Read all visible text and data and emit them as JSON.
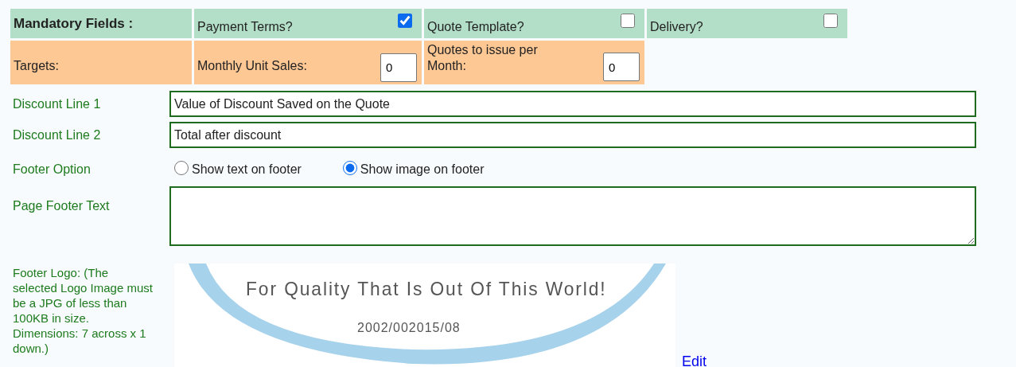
{
  "mandatory": {
    "label": "Mandatory Fields :",
    "items": [
      {
        "label": "Payment Terms?",
        "checked": true
      },
      {
        "label": "Quote Template?",
        "checked": false
      },
      {
        "label": "Delivery?",
        "checked": false
      }
    ]
  },
  "targets": {
    "label": "Targets:",
    "items": [
      {
        "label": "Monthly Unit Sales:",
        "value": "0"
      },
      {
        "label": "Quotes to issue per Month:",
        "value": "0"
      }
    ]
  },
  "discount_lines": [
    {
      "label": "Discount Line 1",
      "value": "Value of Discount Saved on the Quote"
    },
    {
      "label": "Discount Line 2",
      "value": "Total after discount"
    }
  ],
  "footer_option": {
    "label": "Footer Option",
    "options": [
      {
        "label": "Show text on footer",
        "selected": false
      },
      {
        "label": "Show image on footer",
        "selected": true
      }
    ]
  },
  "page_footer_text": {
    "label": "Page Footer Text"
  },
  "footer_logo": {
    "label": "Footer Logo: (The selected Logo Image must be a JPG of less than 100KB in size. Dimensions: 7 across x 1 down.)",
    "slogan": "For Quality That Is Out Of This World!",
    "number": "2002/002015/08",
    "edit_link": "Edit"
  }
}
